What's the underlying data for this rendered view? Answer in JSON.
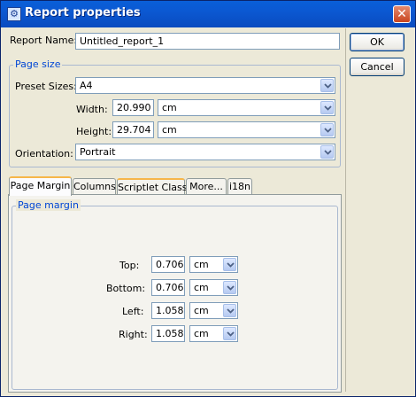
{
  "window": {
    "title": "Report properties",
    "close_label": "✕"
  },
  "report_name": {
    "label": "Report Name:",
    "value": "Untitled_report_1"
  },
  "buttons": {
    "ok": "OK",
    "cancel": "Cancel"
  },
  "page_size": {
    "group_title": "Page size",
    "preset_label": "Preset Sizes:",
    "preset_value": "A4",
    "width_label": "Width:",
    "width_value": "20.990",
    "width_unit": "cm",
    "height_label": "Height:",
    "height_value": "29.704",
    "height_unit": "cm",
    "orientation_label": "Orientation:",
    "orientation_value": "Portrait"
  },
  "tabs": [
    {
      "label": "Page Margin"
    },
    {
      "label": "Columns"
    },
    {
      "label": "Scriptlet Class"
    },
    {
      "label": "More..."
    },
    {
      "label": "i18n"
    }
  ],
  "page_margin": {
    "group_title": "Page margin",
    "rows": [
      {
        "label": "Top:",
        "value": "0.706",
        "unit": "cm"
      },
      {
        "label": "Bottom:",
        "value": "0.706",
        "unit": "cm"
      },
      {
        "label": "Left:",
        "value": "1.058",
        "unit": "cm"
      },
      {
        "label": "Right:",
        "value": "1.058",
        "unit": "cm"
      }
    ]
  }
}
